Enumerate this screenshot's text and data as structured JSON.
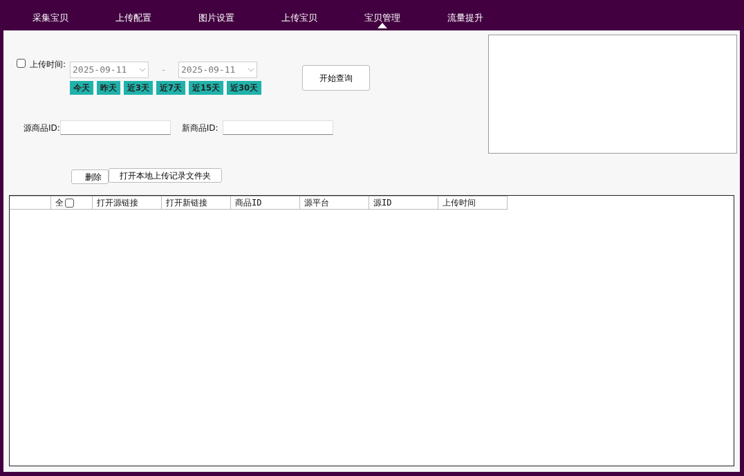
{
  "tabs": [
    {
      "label": "采集宝贝",
      "selected": false
    },
    {
      "label": "上传配置",
      "selected": false
    },
    {
      "label": "图片设置",
      "selected": false
    },
    {
      "label": "上传宝贝",
      "selected": false
    },
    {
      "label": "宝贝管理",
      "selected": true
    },
    {
      "label": "流量提升",
      "selected": false
    }
  ],
  "filter": {
    "time_label": "上传时间:",
    "time_checked": false,
    "date_from": "2025-09-11",
    "separator": "-",
    "date_to": "2025-09-11",
    "quick_ranges": [
      "今天",
      "昨天",
      "近3天",
      "近7天",
      "近15天",
      "近30天"
    ],
    "query_button": "开始查询",
    "source_id_label": "源商品ID:",
    "new_id_label": "新商品ID:"
  },
  "actions": {
    "delete_button": "删除",
    "open_folder_button": "打开本地上传记录文件夹"
  },
  "table": {
    "columns": [
      {},
      {
        "label": "全",
        "kind": "checkbox",
        "checked": false
      },
      {
        "label": "打开源链接"
      },
      {
        "label": "打开新链接"
      },
      {
        "label": "商品ID"
      },
      {
        "label": "源平台"
      },
      {
        "label": "源ID"
      },
      {
        "label": "上传时间"
      }
    ]
  }
}
